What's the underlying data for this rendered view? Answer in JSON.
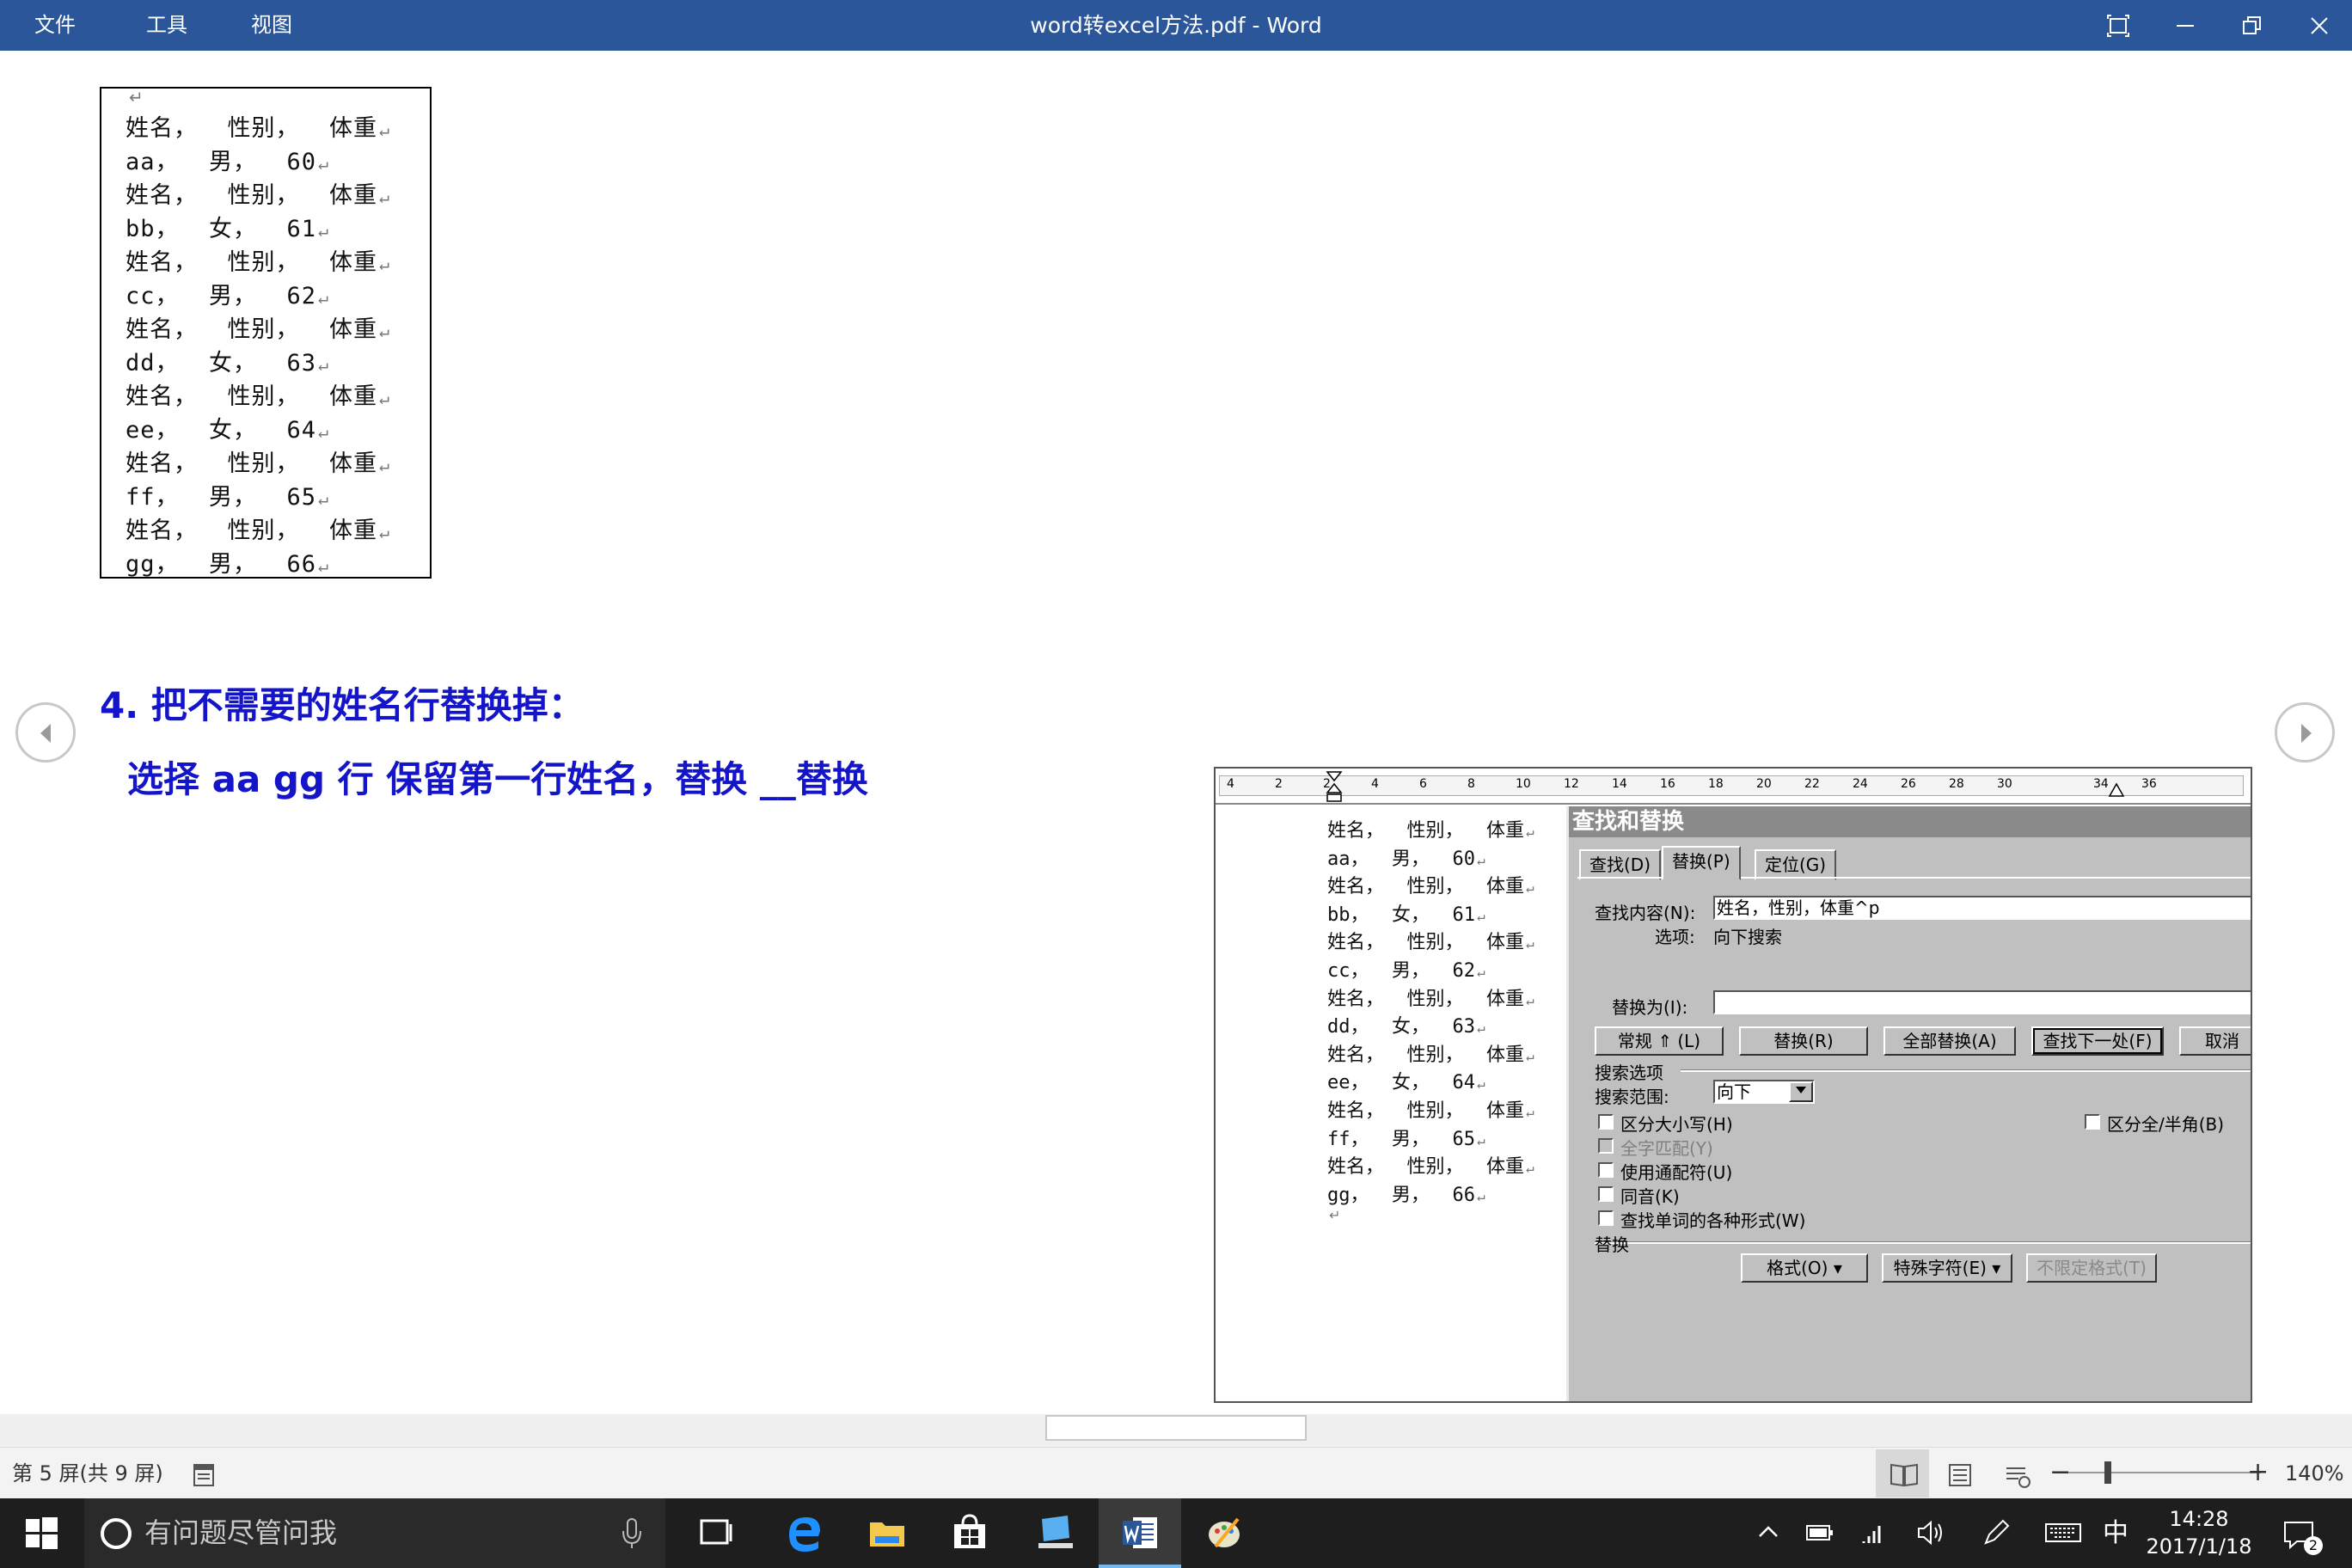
{
  "titlebar": {
    "menus": [
      "文件",
      "工具",
      "视图"
    ],
    "doc_title": "word转excel方法.pdf  -  Word"
  },
  "document": {
    "list_lines": [
      "姓名，  性别，  体重",
      "aa，  男，  60",
      "姓名，  性别，  体重",
      "bb，  女，  61",
      "姓名，  性别，  体重",
      "cc，  男，  62",
      "姓名，  性别，  体重",
      "dd，  女，  63",
      "姓名，  性别，  体重",
      "ee，  女，  64",
      "姓名，  性别，  体重",
      "ff，  男，  65",
      "姓名，  性别，  体重",
      "gg，  男，  66"
    ],
    "return_mark": "↵",
    "heading": "4. 把不需要的姓名行替换掉：",
    "subheading": "选择 aa gg 行 保留第一行姓名，替换 __替换"
  },
  "screenshot": {
    "ruler_ticks": [
      "4",
      "2",
      "2",
      "4",
      "6",
      "8",
      "10",
      "12",
      "14",
      "16",
      "18",
      "20",
      "22",
      "24",
      "26",
      "28",
      "30",
      "34",
      "36"
    ],
    "list_lines": [
      "姓名，  性别，  体重",
      "aa，  男，  60",
      "姓名，  性别，  体重",
      "bb，  女，  61",
      "姓名，  性别，  体重",
      "cc，  男，  62",
      "姓名，  性别，  体重",
      "dd，  女，  63",
      "姓名，  性别，  体重",
      "ee，  女，  64",
      "姓名，  性别，  体重",
      "ff，  男，  65",
      "姓名，  性别，  体重",
      "gg，  男，  66"
    ],
    "dialog": {
      "title": "查找和替换",
      "tabs": [
        "查找(D)",
        "替换(P)",
        "定位(G)"
      ],
      "find_label": "查找内容(N):",
      "find_value": "姓名，性别，体重^p",
      "options_label": "选项:",
      "options_value": "向下搜索",
      "replace_label": "替换为(I):",
      "replace_value": "",
      "buttons": {
        "more": "常规 ⇑ (L)",
        "replace": "替换(R)",
        "replace_all": "全部替换(A)",
        "find_next": "查找下一处(F)",
        "cancel": "取消"
      },
      "search_options_label": "搜索选项",
      "search_scope_label": "搜索范围:",
      "search_scope_value": "向下",
      "checkboxes": {
        "match_case": "区分大小写(H)",
        "whole_word": "全字匹配(Y)",
        "wildcards": "使用通配符(U)",
        "sounds_like": "同音(K)",
        "word_forms": "查找单词的各种形式(W)",
        "full_half": "区分全/半角(B)"
      },
      "replace_section_label": "替换",
      "bottom_buttons": {
        "format": "格式(O) ▾",
        "special": "特殊字符(E) ▾",
        "no_format": "不限定格式(T)"
      }
    }
  },
  "statusbar": {
    "page_status": "第 5 屏(共 9 屏)",
    "zoom": "140%",
    "zoom_minus": "−",
    "zoom_plus": "+"
  },
  "taskbar": {
    "search_placeholder": "有问题尽管问我",
    "ime": "中",
    "time": "14:28",
    "date": "2017/1/18",
    "notification_count": "2"
  },
  "colors": {
    "titlebar": "#2b579a",
    "heading": "#1414c8",
    "taskbar": "#1e1e1e",
    "dialog": "#c0c0c0"
  }
}
